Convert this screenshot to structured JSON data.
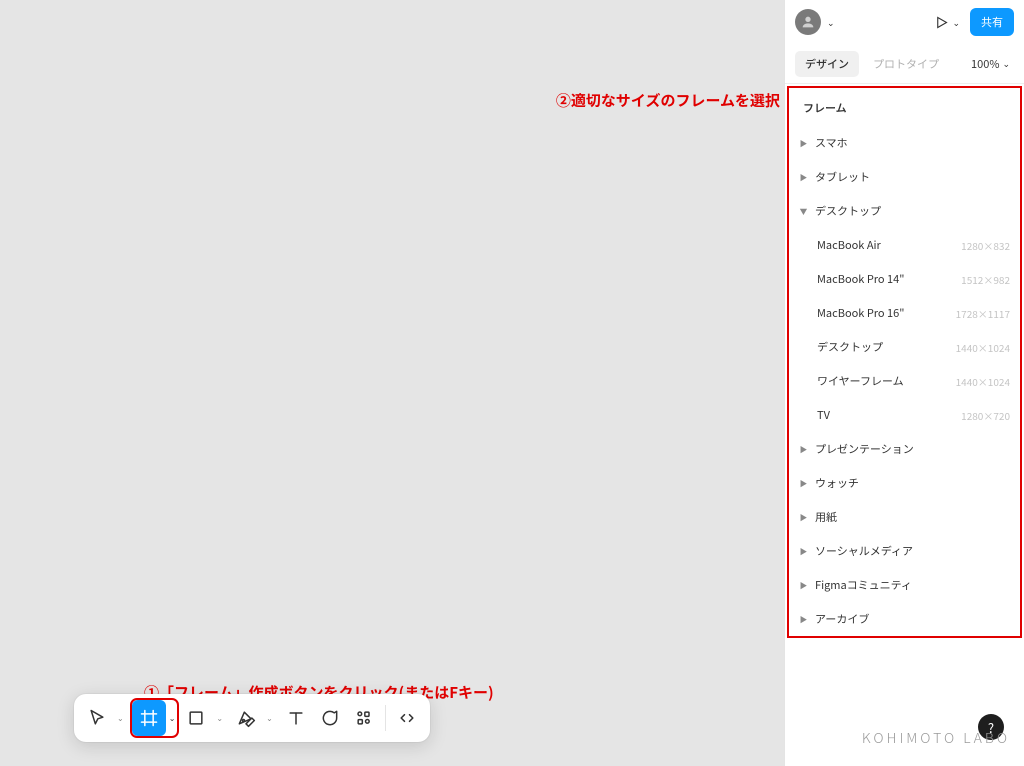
{
  "annotations": {
    "step1": "①「フレーム」作成ボタンをクリック(またはFキー)",
    "step2": "②適切なサイズのフレームを選択"
  },
  "topbar": {
    "share_label": "共有"
  },
  "tabs": {
    "design": "デザイン",
    "prototype": "プロトタイプ",
    "zoom": "100%"
  },
  "frames": {
    "title": "フレーム",
    "categories": [
      {
        "label": "スマホ",
        "expanded": false
      },
      {
        "label": "タブレット",
        "expanded": false
      },
      {
        "label": "デスクトップ",
        "expanded": true,
        "items": [
          {
            "name": "MacBook Air",
            "dim": "1280×832"
          },
          {
            "name": "MacBook Pro 14\"",
            "dim": "1512×982"
          },
          {
            "name": "MacBook Pro 16\"",
            "dim": "1728×1117"
          },
          {
            "name": "デスクトップ",
            "dim": "1440×1024"
          },
          {
            "name": "ワイヤーフレーム",
            "dim": "1440×1024"
          },
          {
            "name": "TV",
            "dim": "1280×720"
          }
        ]
      },
      {
        "label": "プレゼンテーション",
        "expanded": false
      },
      {
        "label": "ウォッチ",
        "expanded": false
      },
      {
        "label": "用紙",
        "expanded": false
      },
      {
        "label": "ソーシャルメディア",
        "expanded": false
      },
      {
        "label": "Figmaコミュニティ",
        "expanded": false
      },
      {
        "label": "アーカイブ",
        "expanded": false
      }
    ]
  },
  "watermark": "KOHIMOTO LABO",
  "help": "?"
}
